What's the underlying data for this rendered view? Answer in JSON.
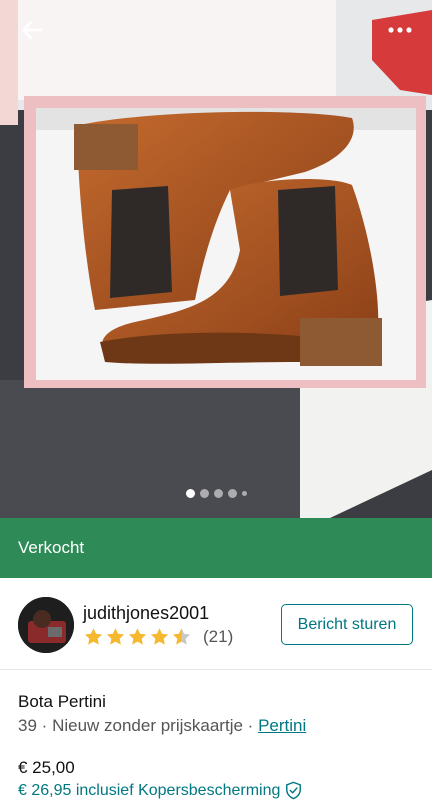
{
  "nav": {
    "back_icon": "arrow-left-icon",
    "more_icon": "more-dots-icon"
  },
  "gallery": {
    "total": 5,
    "active_index": 0
  },
  "status": {
    "label": "Verkocht",
    "color": "#2e8b57"
  },
  "seller": {
    "username": "judithjones2001",
    "rating": 4.5,
    "rating_count": "(21)"
  },
  "actions": {
    "message_label": "Bericht sturen"
  },
  "item": {
    "title": "Bota Pertini",
    "size": "39",
    "sep": "·",
    "condition": "Nieuw zonder prijskaartje",
    "brand": "Pertini",
    "price": "€ 25,00",
    "price_with_protection": "€ 26,95 inclusief Kopersbescherming"
  },
  "colors": {
    "accent": "#007782",
    "sold": "#2e8b57",
    "star": "#f5b82e"
  }
}
